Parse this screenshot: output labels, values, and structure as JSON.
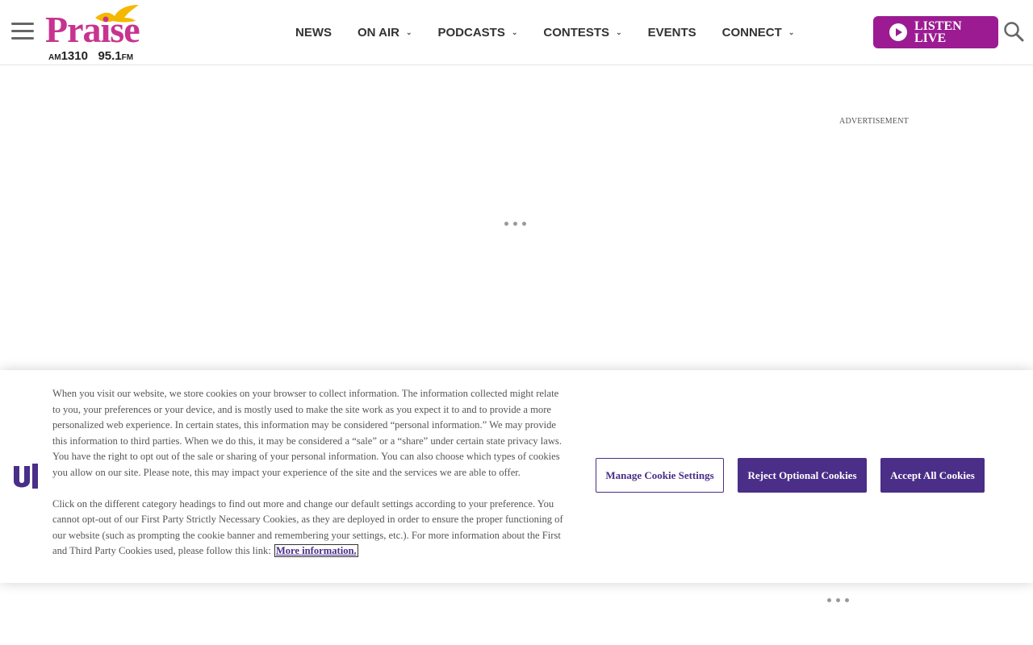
{
  "header": {
    "logo": {
      "brand": "Praise",
      "am_prefix": "AM",
      "am_freq": "1310",
      "fm_freq": "95.1",
      "fm_suffix": "FM"
    },
    "nav": [
      {
        "label": "NEWS",
        "has_dropdown": false
      },
      {
        "label": "ON AIR",
        "has_dropdown": true
      },
      {
        "label": "PODCASTS",
        "has_dropdown": true
      },
      {
        "label": "CONTESTS",
        "has_dropdown": true
      },
      {
        "label": "EVENTS",
        "has_dropdown": false
      },
      {
        "label": "CONNECT",
        "has_dropdown": true
      }
    ],
    "listen_live_label": "LISTEN LIVE",
    "icons": {
      "menu": "hamburger-icon",
      "play": "play-icon",
      "search": "search-icon",
      "caret": "chevron-down-icon"
    }
  },
  "ad": {
    "label": "ADVERTISEMENT"
  },
  "cookie_banner": {
    "paragraph_1": "When you visit our website, we store cookies on your browser to collect information. The information collected might relate to you, your preferences or your device, and is mostly used to make the site work as you expect it to and to provide a more personalized web experience. In certain states, this information may be considered “personal information.” We may provide this information to third parties. When we do this, it may be considered a “sale” or a “share” under certain state privacy laws. You have the right to opt out of the sale or sharing of your personal information. You can also choose which types of cookies you allow on our site. Please note, this may impact your experience of the site and the services we are able to offer.",
    "paragraph_2": "Click on the different category headings to find out more and change our default settings according to your preference. You cannot opt-out of our First Party Strictly Necessary Cookies, as they are deployed in order to ensure the proper functioning of our website (such as prompting the cookie banner and remembering your settings, etc.). For more information about the First and Third Party Cookies used, please follow this link:",
    "more_info_link": "More information.",
    "buttons": {
      "manage": "Manage Cookie Settings",
      "reject": "Reject Optional Cookies",
      "accept": "Accept All Cookies"
    }
  },
  "colors": {
    "brand_pink": "#c7338f",
    "listen_purple": "#9c1b92",
    "cookie_purple": "#4a2e87"
  }
}
